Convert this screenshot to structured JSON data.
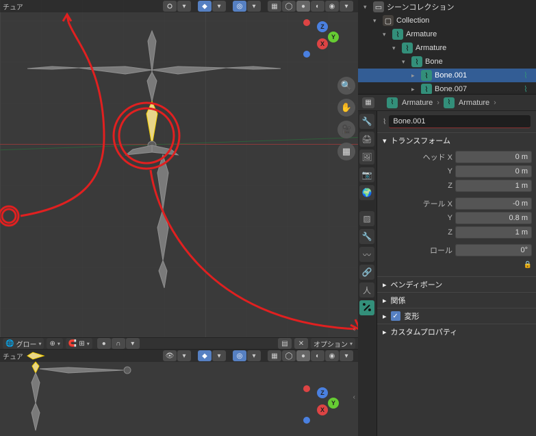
{
  "viewport": {
    "header_label": "チュア",
    "mode_dropdown": "グロー",
    "options_label": "オプション",
    "axis_z": "Z",
    "axis_x": "X",
    "axis_y": "Y"
  },
  "outliner": {
    "items": [
      {
        "indent": 0,
        "label": "シーンコレクション",
        "icon": "scene",
        "expanded": true
      },
      {
        "indent": 1,
        "label": "Collection",
        "icon": "collection",
        "expanded": true
      },
      {
        "indent": 2,
        "label": "Armature",
        "icon": "armature",
        "expanded": true
      },
      {
        "indent": 3,
        "label": "Armature",
        "icon": "armature",
        "expanded": true
      },
      {
        "indent": 4,
        "label": "Bone",
        "icon": "bone",
        "expanded": true
      },
      {
        "indent": 5,
        "label": "Bone.001",
        "icon": "bone",
        "expanded": false,
        "selected": true,
        "rest": true
      },
      {
        "indent": 5,
        "label": "Bone.007",
        "icon": "bone",
        "expanded": false,
        "rest": true
      }
    ]
  },
  "breadcrumb": {
    "obj": "Armature",
    "data": "Armature"
  },
  "bone_name": "Bone.001",
  "sections": {
    "transform": "トランスフォーム",
    "bendy": "ベンディボーン",
    "relations": "関係",
    "deform": "変形",
    "custom": "カスタムプロパティ"
  },
  "transform": {
    "head_label": "ヘッド X",
    "head_x": "0 m",
    "y1_label": "Y",
    "head_y": "0 m",
    "z1_label": "Z",
    "head_z": "1 m",
    "tail_label": "テール X",
    "tail_x": "-0 m",
    "y2_label": "Y",
    "tail_y": "0.8 m",
    "z2_label": "Z",
    "tail_z": "1 m",
    "roll_label": "ロール",
    "roll": "0°"
  },
  "deform_checked": true,
  "colors": {
    "accent": "#5680c2",
    "bone_tab": "#338f7a",
    "annotation": "#e02020"
  }
}
